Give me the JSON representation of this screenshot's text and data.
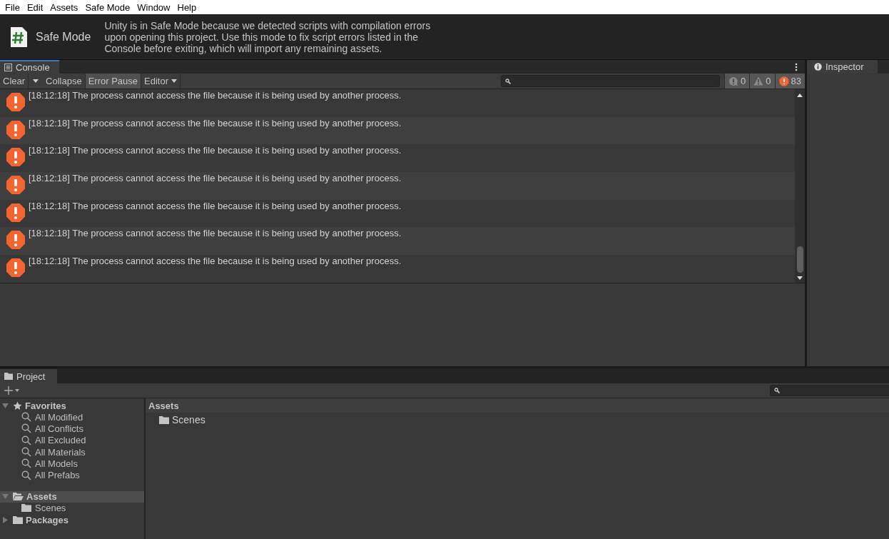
{
  "menu": [
    "File",
    "Edit",
    "Assets",
    "Safe Mode",
    "Window",
    "Help"
  ],
  "banner": {
    "title": "Safe Mode",
    "message": "Unity is in Safe Mode because we detected scripts with compilation errors upon opening this project. Use this mode to fix script errors listed in the Console before exiting, which will import any remaining assets."
  },
  "console": {
    "tab": "Console",
    "toolbar": [
      {
        "label": "Clear",
        "on": false
      },
      {
        "label": "Collapse",
        "on": false
      },
      {
        "label": "Error Pause",
        "on": true
      },
      {
        "label": "Editor",
        "on": false
      }
    ],
    "counters": [
      {
        "kind": "info",
        "count": "0"
      },
      {
        "kind": "warning",
        "count": "0"
      },
      {
        "kind": "error",
        "count": "83"
      }
    ],
    "entries": [
      {
        "kind": "error",
        "text": "[18:12:18] The process cannot access the file because it is being used by another process."
      },
      {
        "kind": "error",
        "text": "[18:12:18] The process cannot access the file because it is being used by another process."
      },
      {
        "kind": "error",
        "text": "[18:12:18] The process cannot access the file because it is being used by another process."
      },
      {
        "kind": "error",
        "text": "[18:12:18] The process cannot access the file because it is being used by another process."
      },
      {
        "kind": "error",
        "text": "[18:12:18] The process cannot access the file because it is being used by another process."
      },
      {
        "kind": "error",
        "text": "[18:12:18] The process cannot access the file because it is being used by another process."
      },
      {
        "kind": "error",
        "text": "[18:12:18] The process cannot access the file because it is being used by another process."
      }
    ]
  },
  "inspector": {
    "tab": "Inspector"
  },
  "project": {
    "tab": "Project",
    "tree": [
      {
        "label": "Favorites",
        "kind": "favorites",
        "expanded": true,
        "selected": false,
        "children": [
          {
            "label": "All Modified",
            "kind": "search"
          },
          {
            "label": "All Conflicts",
            "kind": "search"
          },
          {
            "label": "All Excluded",
            "kind": "search"
          },
          {
            "label": "All Materials",
            "kind": "search"
          },
          {
            "label": "All Models",
            "kind": "search"
          },
          {
            "label": "All Prefabs",
            "kind": "search"
          }
        ]
      },
      {
        "label": "Assets",
        "kind": "folder",
        "expanded": true,
        "selected": true,
        "children": [
          {
            "label": "Scenes",
            "kind": "folder"
          }
        ]
      },
      {
        "label": "Packages",
        "kind": "folder",
        "expanded": false,
        "selected": false
      }
    ],
    "breadcrumb": "Assets",
    "items": [
      "Scenes"
    ]
  }
}
